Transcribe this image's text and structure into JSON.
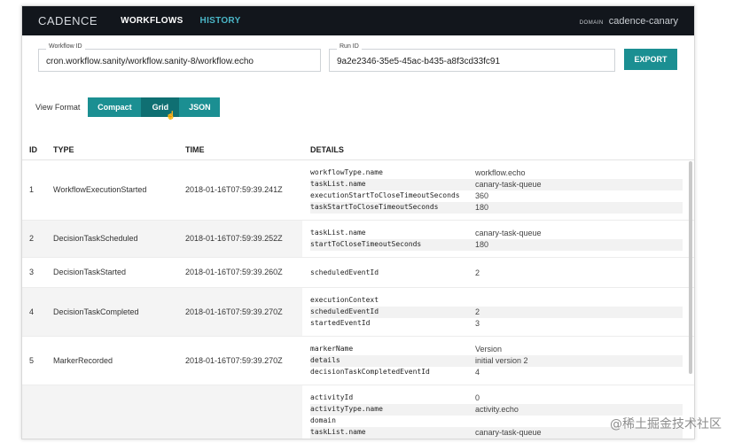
{
  "nav": {
    "brand": "CADENCE",
    "workflows": "WORKFLOWS",
    "history": "HISTORY",
    "domain_label": "DOMAIN",
    "domain_value": "cadence-canary"
  },
  "fields": {
    "workflow_id_label": "Workflow ID",
    "workflow_id_value": "cron.workflow.sanity/workflow.sanity-8/workflow.echo",
    "run_id_label": "Run ID",
    "run_id_value": "9a2e2346-35e5-45ac-b435-a8f3cd33fc91",
    "export_label": "EXPORT"
  },
  "view_format": {
    "label": "View Format",
    "compact": "Compact",
    "grid": "Grid",
    "json": "JSON"
  },
  "table": {
    "headers": {
      "id": "ID",
      "type": "TYPE",
      "time": "TIME",
      "details": "DETAILS"
    },
    "rows": [
      {
        "id": "1",
        "type": "WorkflowExecutionStarted",
        "time": "2018-01-16T07:59:39.241Z",
        "details": [
          {
            "k": "workflowType.name",
            "v": "workflow.echo"
          },
          {
            "k": "taskList.name",
            "v": "canary-task-queue"
          },
          {
            "k": "executionStartToCloseTimeoutSeconds",
            "v": "360"
          },
          {
            "k": "taskStartToCloseTimeoutSeconds",
            "v": "180"
          }
        ]
      },
      {
        "id": "2",
        "type": "DecisionTaskScheduled",
        "time": "2018-01-16T07:59:39.252Z",
        "details": [
          {
            "k": "taskList.name",
            "v": "canary-task-queue"
          },
          {
            "k": "startToCloseTimeoutSeconds",
            "v": "180"
          }
        ]
      },
      {
        "id": "3",
        "type": "DecisionTaskStarted",
        "time": "2018-01-16T07:59:39.260Z",
        "details": [
          {
            "k": "scheduledEventId",
            "v": "2"
          }
        ]
      },
      {
        "id": "4",
        "type": "DecisionTaskCompleted",
        "time": "2018-01-16T07:59:39.270Z",
        "details": [
          {
            "k": "executionContext",
            "v": ""
          },
          {
            "k": "scheduledEventId",
            "v": "2"
          },
          {
            "k": "startedEventId",
            "v": "3"
          }
        ]
      },
      {
        "id": "5",
        "type": "MarkerRecorded",
        "time": "2018-01-16T07:59:39.270Z",
        "details": [
          {
            "k": "markerName",
            "v": "Version"
          },
          {
            "k": "details",
            "v": "initial version 2"
          },
          {
            "k": "decisionTaskCompletedEventId",
            "v": "4"
          }
        ]
      },
      {
        "id": "",
        "type": "",
        "time": "",
        "details": [
          {
            "k": "activityId",
            "v": "0"
          },
          {
            "k": "activityType.name",
            "v": "activity.echo"
          },
          {
            "k": "domain",
            "v": ""
          },
          {
            "k": "taskList.name",
            "v": "canary-task-queue"
          }
        ]
      }
    ]
  },
  "watermark": "@稀土掘金技术社区"
}
